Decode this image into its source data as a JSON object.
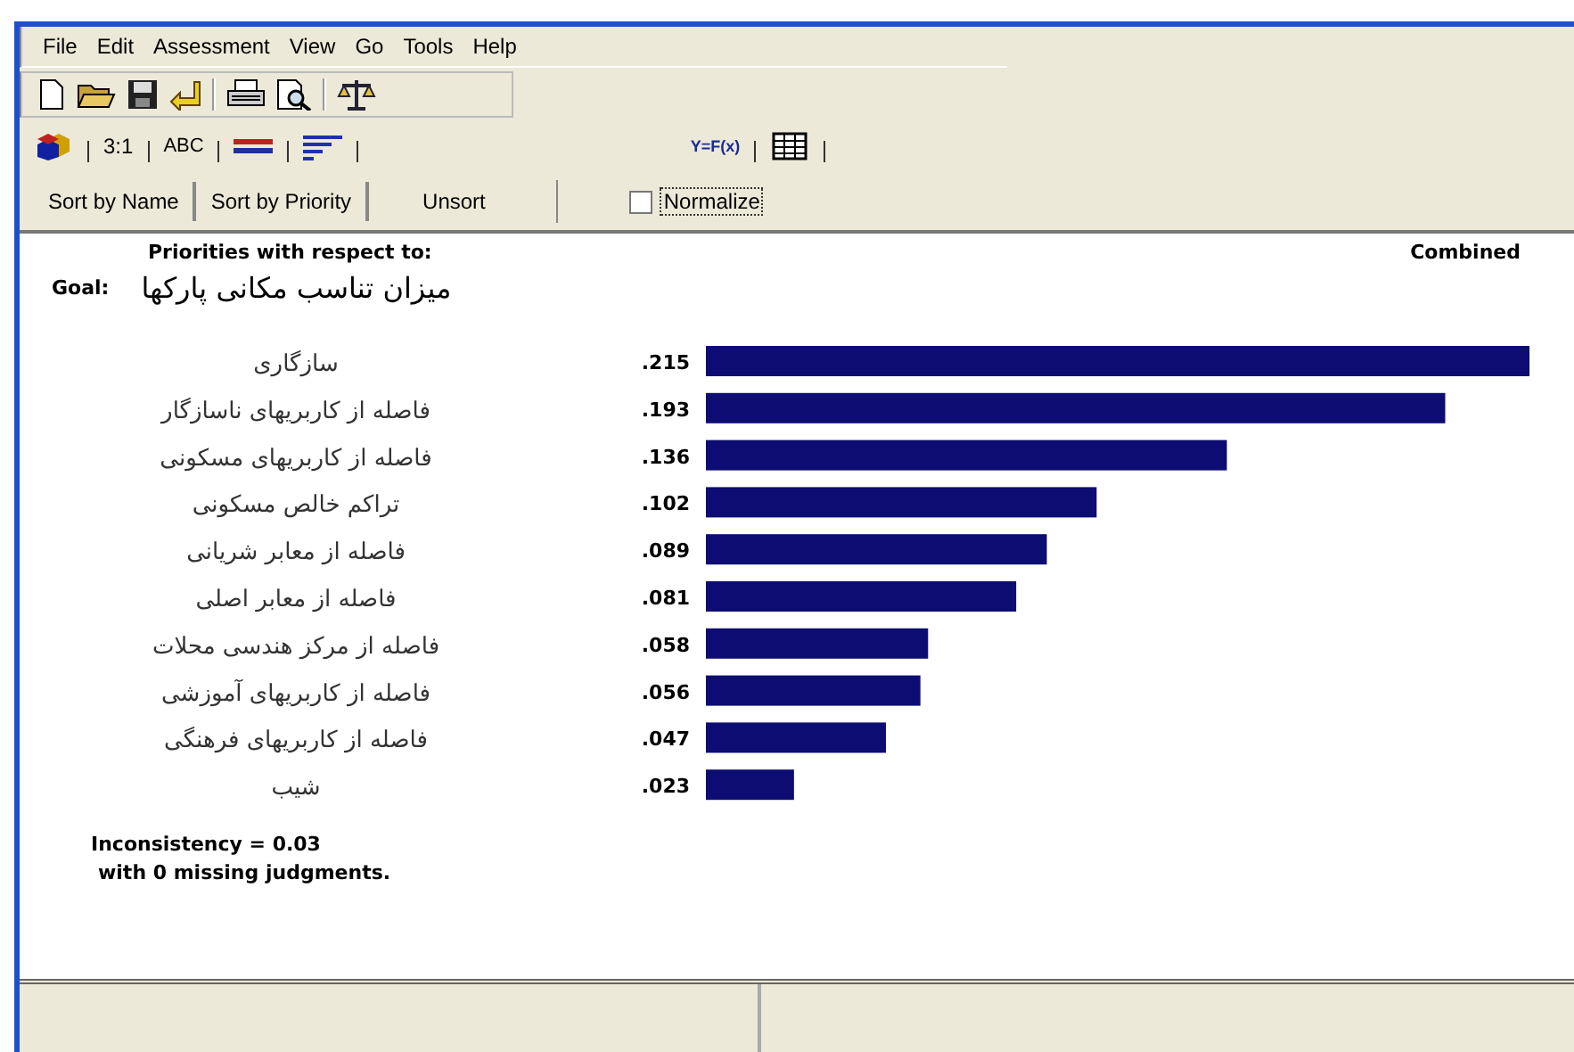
{
  "menu": [
    "File",
    "Edit",
    "Assessment",
    "View",
    "Go",
    "Tools",
    "Help"
  ],
  "mode_tabs": [
    {
      "label": "3:1"
    },
    {
      "label": "ABC"
    },
    {
      "label": "Y=F(x)"
    }
  ],
  "sort_buttons": [
    {
      "label": "Sort by Name"
    },
    {
      "label": "Sort by Priority"
    },
    {
      "label": "Unsort"
    }
  ],
  "normalize": {
    "label": "Normalize",
    "checked": false
  },
  "priorities": {
    "heading": "Priorities with respect to:",
    "mode": "Combined",
    "goal_label": "Goal:",
    "goal": "میزان تناسب مکانی پارکها",
    "chart_data": {
      "type": "bar",
      "orientation": "horizontal",
      "categories": [
        "سازگاری",
        "فاصله از کاربریهای ناسازگار",
        "فاصله از کاربریهای مسکونی",
        "تراکم خالص مسکونی",
        "فاصله از معابر شریانی",
        "فاصله از معابر اصلی",
        "فاصله از مرکز هندسی محلات",
        "فاصله از کاربریهای آموزشی",
        "فاصله از کاربریهای فرهنگی",
        "شیب"
      ],
      "values": [
        0.215,
        0.193,
        0.136,
        0.102,
        0.089,
        0.081,
        0.058,
        0.056,
        0.047,
        0.023
      ],
      "value_labels": [
        ".215",
        ".193",
        ".136",
        ".102",
        ".089",
        ".081",
        ".058",
        ".056",
        ".047",
        ".023"
      ]
    }
  },
  "inconsistency": "Inconsistency = 0.03",
  "missing": "with 0  missing judgments."
}
